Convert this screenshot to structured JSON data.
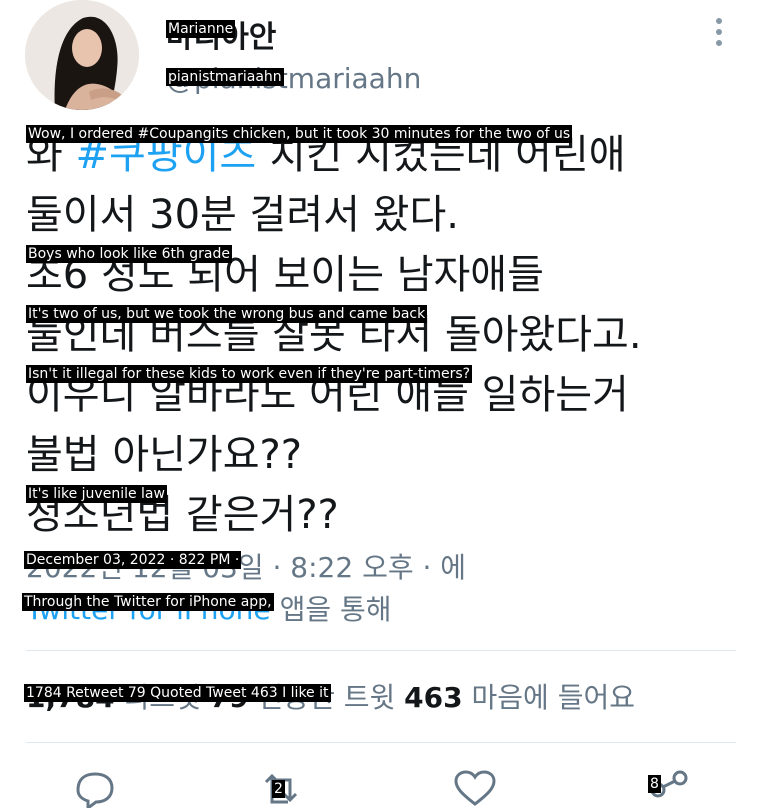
{
  "tweet": {
    "author_name_ko": "마리아안",
    "author_handle_ko": "@pianistmariaahn",
    "body_ko": [
      {
        "tag": "#쿠팡이츠",
        "rest": " 치킨 시켰는데 어린애",
        "prefix": "와 "
      },
      {
        "text": "둘이서 30분 걸려서 왔다."
      },
      {
        "text": "초6 정도 되어 보이는 남자애들"
      },
      {
        "text": "둘인데 버스를 잘못 타서 돌아왔다고."
      },
      {
        "text": "이우니 알바라도 어린 애들 일하는거"
      },
      {
        "text": "불법 아닌가요??"
      },
      {
        "text": "청소년법 같은거??"
      }
    ],
    "timestamp_ko": "2022년 12월 03일 · 8:22 오후 · 에",
    "source_ko_app": "Twitter for iPhone",
    "source_ko_rest": " 앱을 통해",
    "stats_ko": {
      "retweets": "1,784",
      "retweets_label": "리트윗",
      "quotes": "79",
      "quotes_label": "인용한 트윗",
      "likes": "463",
      "likes_label": "마음에 들어요"
    }
  },
  "captions": {
    "name": "Marianne",
    "handle": "pianistmariaahn",
    "line1": "Wow, I ordered #Coupangits chicken, but it took 30 minutes for the two of us",
    "line2": "Boys who look like 6th grade",
    "line3": "It's two of us, but we took the wrong bus and came back",
    "line4": "Isn't it illegal for these kids to work even if they're part-timers?",
    "line5": "It's like juvenile law",
    "timestamp": "December 03, 2022 · 822 PM ·",
    "source": "Through the Twitter for iPhone app,",
    "stats": "1784 Retweet 79 Quoted Tweet 463 I like it",
    "action_2": "2",
    "action_8": "8"
  },
  "icons": {
    "reply": "reply-icon",
    "retweet": "retweet-icon",
    "like": "heart-icon",
    "share": "share-icon",
    "more": "more-vertical-icon"
  },
  "colors": {
    "link": "#1da1f2",
    "secondary": "#657786",
    "text": "#14171a"
  }
}
